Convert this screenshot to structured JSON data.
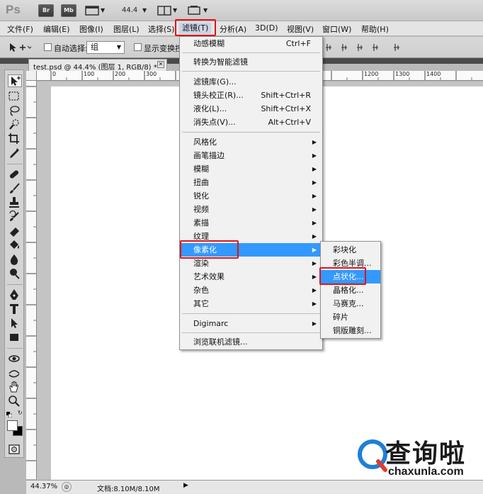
{
  "app": {
    "logo": "Ps",
    "bridge_label": "Br",
    "minibridge_label": "Mb",
    "zoom_value": "44.4"
  },
  "menubar": {
    "items": [
      "文件(F)",
      "编辑(E)",
      "图像(I)",
      "图层(L)",
      "选择(S)",
      "滤镜(T)",
      "分析(A)",
      "3D(D)",
      "视图(V)",
      "窗口(W)",
      "帮助(H)"
    ]
  },
  "options": {
    "auto_select_label": "自动选择:",
    "auto_select_value": "组",
    "show_transform_label": "显示变换控"
  },
  "document": {
    "tab_title": "test.psd @ 44.4% (图层 1, RGB/8) *",
    "ruler_top_ticks": [
      "0",
      "100",
      "200",
      "300",
      "1200",
      "1300",
      "1400"
    ]
  },
  "filter_menu": {
    "items": [
      {
        "label": "动感模糊",
        "shortcut": "Ctrl+F"
      },
      {
        "label": "转换为智能滤镜"
      },
      {
        "label": "滤镜库(G)..."
      },
      {
        "label": "镜头校正(R)...",
        "shortcut": "Shift+Ctrl+R"
      },
      {
        "label": "液化(L)...",
        "shortcut": "Shift+Ctrl+X"
      },
      {
        "label": "消失点(V)...",
        "shortcut": "Alt+Ctrl+V"
      },
      {
        "label": "风格化"
      },
      {
        "label": "画笔描边"
      },
      {
        "label": "模糊"
      },
      {
        "label": "扭曲"
      },
      {
        "label": "锐化"
      },
      {
        "label": "视频"
      },
      {
        "label": "素描"
      },
      {
        "label": "纹理"
      },
      {
        "label": "像素化"
      },
      {
        "label": "渲染"
      },
      {
        "label": "艺术效果"
      },
      {
        "label": "杂色"
      },
      {
        "label": "其它"
      },
      {
        "label": "Digimarc"
      },
      {
        "label": "浏览联机滤镜..."
      }
    ]
  },
  "pixelate_submenu": {
    "items": [
      "彩块化",
      "彩色半调...",
      "点状化...",
      "晶格化...",
      "马赛克...",
      "碎片",
      "铜版雕刻..."
    ]
  },
  "status": {
    "zoom": "44.37%",
    "doc_size": "文档:8.10M/8.10M"
  },
  "watermark": {
    "cn": "查询啦",
    "en": "chaxunla.com"
  },
  "colors": {
    "highlight": "#3399ff",
    "annotation_red": "#e0141a"
  }
}
